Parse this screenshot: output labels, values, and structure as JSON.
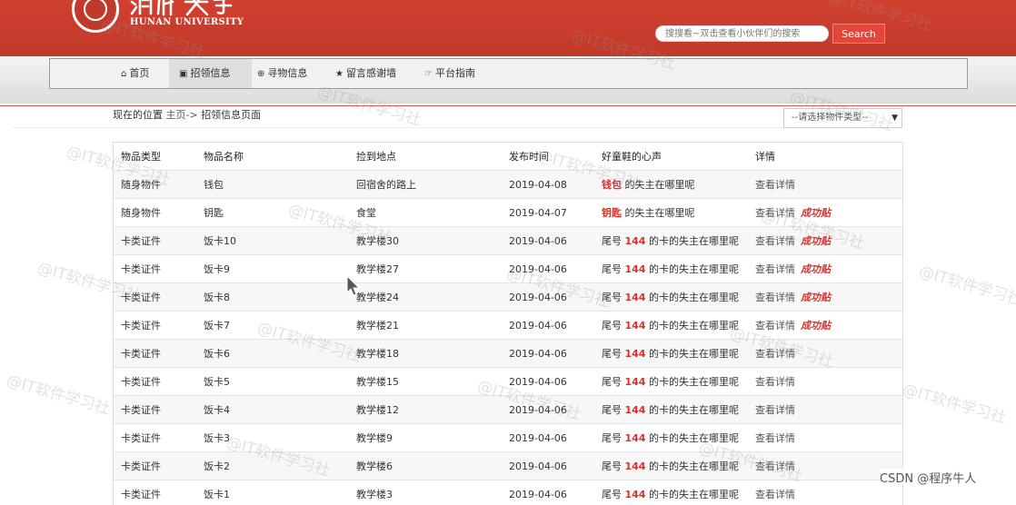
{
  "header": {
    "university_en": "HUNAN UNIVERSITY",
    "university_cn": "湖南大学",
    "search_placeholder": "搜搜看~双击查看小伙伴们的搜索",
    "search_button": "Search"
  },
  "nav": {
    "items": [
      {
        "label": "首页",
        "icon": "home-icon",
        "glyph": "⌂"
      },
      {
        "label": "招领信息",
        "icon": "picture-icon",
        "glyph": "▣"
      },
      {
        "label": "寻物信息",
        "icon": "search-icon",
        "glyph": "⊕"
      },
      {
        "label": "留言感谢墙",
        "icon": "star-icon",
        "glyph": "★"
      },
      {
        "label": "平台指南",
        "icon": "hand-pointer-icon",
        "glyph": "☞"
      }
    ]
  },
  "breadcrumb": {
    "prefix": "现在的位置",
    "home": "主页->",
    "current": "招领信息页面"
  },
  "type_select": {
    "selected": "--请选择物件类型--"
  },
  "table": {
    "headers": [
      "物品类型",
      "物品名称",
      "捡到地点",
      "发布时间",
      "好童鞋的心声",
      "详情"
    ],
    "rows": [
      {
        "type": "随身物件",
        "name": "钱包",
        "place": "回宿舍的路上",
        "date": "2019-04-08",
        "msg_pre": "",
        "msg_hl": "钱包",
        "msg_post": " 的失主在哪里呢",
        "detail": "查看详情",
        "badge": ""
      },
      {
        "type": "随身物件",
        "name": "钥匙",
        "place": "食堂",
        "date": "2019-04-07",
        "msg_pre": "",
        "msg_hl": "钥匙",
        "msg_post": " 的失主在哪里呢",
        "detail": "查看详情",
        "badge": "成功贴"
      },
      {
        "type": "卡类证件",
        "name": "饭卡10",
        "place": "教学楼30",
        "date": "2019-04-06",
        "msg_pre": "尾号 ",
        "msg_hl": "144",
        "msg_post": " 的卡的失主在哪里呢",
        "detail": "查看详情",
        "badge": "成功贴"
      },
      {
        "type": "卡类证件",
        "name": "饭卡9",
        "place": "教学楼27",
        "date": "2019-04-06",
        "msg_pre": "尾号 ",
        "msg_hl": "144",
        "msg_post": " 的卡的失主在哪里呢",
        "detail": "查看详情",
        "badge": "成功贴"
      },
      {
        "type": "卡类证件",
        "name": "饭卡8",
        "place": "教学楼24",
        "date": "2019-04-06",
        "msg_pre": "尾号 ",
        "msg_hl": "144",
        "msg_post": " 的卡的失主在哪里呢",
        "detail": "查看详情",
        "badge": "成功贴"
      },
      {
        "type": "卡类证件",
        "name": "饭卡7",
        "place": "教学楼21",
        "date": "2019-04-06",
        "msg_pre": "尾号 ",
        "msg_hl": "144",
        "msg_post": " 的卡的失主在哪里呢",
        "detail": "查看详情",
        "badge": "成功贴"
      },
      {
        "type": "卡类证件",
        "name": "饭卡6",
        "place": "教学楼18",
        "date": "2019-04-06",
        "msg_pre": "尾号 ",
        "msg_hl": "144",
        "msg_post": " 的卡的失主在哪里呢",
        "detail": "查看详情",
        "badge": ""
      },
      {
        "type": "卡类证件",
        "name": "饭卡5",
        "place": "教学楼15",
        "date": "2019-04-06",
        "msg_pre": "尾号 ",
        "msg_hl": "144",
        "msg_post": " 的卡的失主在哪里呢",
        "detail": "查看详情",
        "badge": ""
      },
      {
        "type": "卡类证件",
        "name": "饭卡4",
        "place": "教学楼12",
        "date": "2019-04-06",
        "msg_pre": "尾号 ",
        "msg_hl": "144",
        "msg_post": " 的卡的失主在哪里呢",
        "detail": "查看详情",
        "badge": ""
      },
      {
        "type": "卡类证件",
        "name": "饭卡3",
        "place": "教学楼9",
        "date": "2019-04-06",
        "msg_pre": "尾号 ",
        "msg_hl": "144",
        "msg_post": " 的卡的失主在哪里呢",
        "detail": "查看详情",
        "badge": ""
      },
      {
        "type": "卡类证件",
        "name": "饭卡2",
        "place": "教学楼6",
        "date": "2019-04-06",
        "msg_pre": "尾号 ",
        "msg_hl": "144",
        "msg_post": " 的卡的失主在哪里呢",
        "detail": "查看详情",
        "badge": ""
      },
      {
        "type": "卡类证件",
        "name": "饭卡1",
        "place": "教学楼3",
        "date": "2019-04-06",
        "msg_pre": "尾号 ",
        "msg_hl": "144",
        "msg_post": " 的卡的失主在哪里呢",
        "detail": "查看详情",
        "badge": ""
      }
    ]
  },
  "watermark": "@IT软件学习社",
  "credit": "CSDN @程序牛人",
  "colors": {
    "header_red": "#c1392a",
    "highlight_red": "#d9312b",
    "nav_bg": "#f1f1f1"
  }
}
